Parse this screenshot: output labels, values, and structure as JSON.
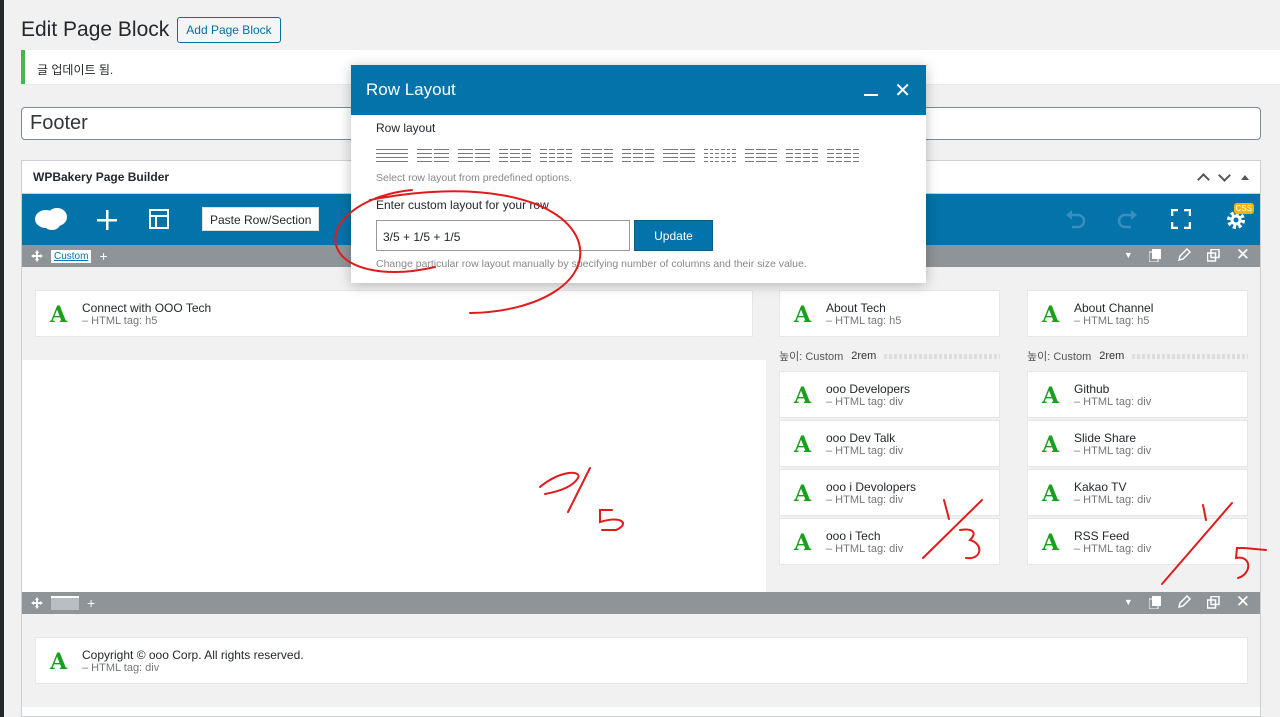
{
  "page": {
    "title": "Edit Page Block",
    "add_button": "Add Page Block",
    "notice": "글 업데이트 됨.",
    "post_title": "Footer"
  },
  "builder": {
    "title": "WPBakery Page Builder",
    "paste_label": "Paste Row/Section",
    "css_badge": "CSS"
  },
  "row1": {
    "tab_label": "Custom",
    "col1": [
      {
        "name": "Connect with OOO Tech",
        "sub": "– HTML tag: h5"
      }
    ],
    "col2": {
      "header": {
        "name": "About Tech",
        "sub": "– HTML tag: h5"
      },
      "spacer_label": "높이: Custom",
      "spacer_value": "2rem",
      "items": [
        {
          "name": "ooo Developers",
          "sub": "– HTML tag: div"
        },
        {
          "name": "ooo Dev Talk",
          "sub": "– HTML tag: div"
        },
        {
          "name": "ooo i Devolopers",
          "sub": "– HTML tag: div"
        },
        {
          "name": "ooo i Tech",
          "sub": "– HTML tag: div"
        }
      ]
    },
    "col3": {
      "header": {
        "name": "About Channel",
        "sub": "– HTML tag: h5"
      },
      "spacer_label": "높이: Custom",
      "spacer_value": "2rem",
      "items": [
        {
          "name": "Github",
          "sub": "– HTML tag: div"
        },
        {
          "name": "Slide Share",
          "sub": "– HTML tag: div"
        },
        {
          "name": "Kakao TV",
          "sub": "– HTML tag: div"
        },
        {
          "name": "RSS Feed",
          "sub": "– HTML tag: div"
        }
      ]
    }
  },
  "row2": {
    "items": [
      {
        "name": "Copyright © ooo Corp. All rights reserved.",
        "sub": "– HTML tag: div"
      }
    ]
  },
  "modal": {
    "title": "Row Layout",
    "row_layout_label": "Row layout",
    "predefined_hint": "Select row layout from predefined options.",
    "custom_label": "Enter custom layout for your row",
    "custom_value": "3/5 + 1/5 + 1/5",
    "update_button": "Update",
    "custom_hint": "Change particular row layout manually by specifying number of columns and their size value.",
    "layout_presets": [
      [
        1
      ],
      [
        1,
        1
      ],
      [
        1,
        1
      ],
      [
        1,
        1,
        1
      ],
      [
        1,
        1,
        1,
        1
      ],
      [
        1,
        1,
        1
      ],
      [
        1,
        1,
        1
      ],
      [
        1,
        1
      ],
      [
        1,
        1,
        1,
        1,
        1,
        1
      ],
      [
        1,
        1,
        1
      ],
      [
        1,
        1,
        1,
        1
      ],
      [
        1,
        1,
        1,
        1
      ]
    ]
  },
  "annotations": {
    "text_3_5": "3/5",
    "text_1_5_a": "1/5",
    "text_1_5_b": "1/5",
    "color": "#e01b1b"
  }
}
